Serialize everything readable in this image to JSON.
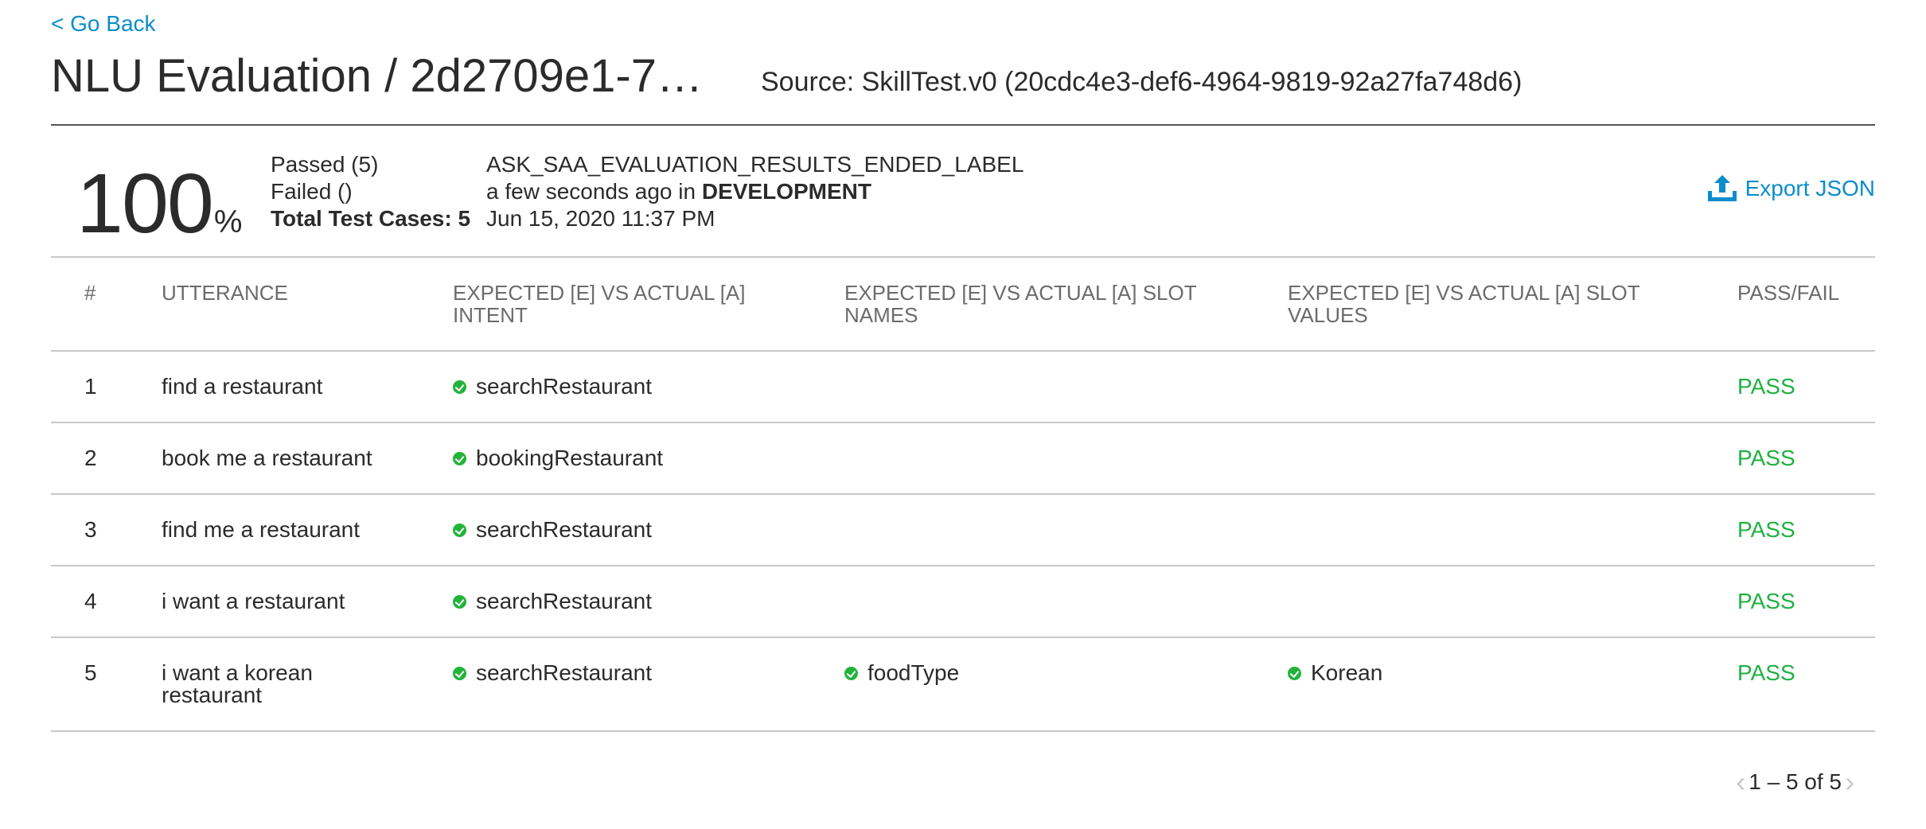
{
  "nav": {
    "back_label": "< Go Back"
  },
  "header": {
    "title": "NLU Evaluation / 2d2709e1-7…",
    "source": "Source: SkillTest.v0 (20cdc4e3-def6-4964-9819-92a27fa748d6)"
  },
  "summary": {
    "percent": "100",
    "percent_sign": "%",
    "passed": "Passed (5)",
    "failed": "Failed ()",
    "total": "Total Test Cases: 5",
    "status_label": "ASK_SAA_EVALUATION_RESULTS_ENDED_LABEL",
    "when_prefix": "a few seconds ago in ",
    "environment": "DEVELOPMENT",
    "date": "Jun 15, 2020 11:37 PM"
  },
  "export": {
    "label": "Export JSON",
    "icon": "upload-icon"
  },
  "table": {
    "headers": {
      "num": "#",
      "utterance": "UTTERANCE",
      "intent": "EXPECTED [E] VS ACTUAL [A] INTENT",
      "slot_names": "EXPECTED [E] VS ACTUAL [A] SLOT NAMES",
      "slot_values": "EXPECTED [E] VS ACTUAL [A] SLOT VALUES",
      "result": "PASS/FAIL"
    },
    "rows": [
      {
        "num": "1",
        "utterance": "find a restaurant",
        "intent": "searchRestaurant",
        "slot_name": "",
        "slot_value": "",
        "result": "PASS"
      },
      {
        "num": "2",
        "utterance": "book me a restaurant",
        "intent": "bookingRestaurant",
        "slot_name": "",
        "slot_value": "",
        "result": "PASS"
      },
      {
        "num": "3",
        "utterance": "find me a restaurant",
        "intent": "searchRestaurant",
        "slot_name": "",
        "slot_value": "",
        "result": "PASS"
      },
      {
        "num": "4",
        "utterance": "i want a restaurant",
        "intent": "searchRestaurant",
        "slot_name": "",
        "slot_value": "",
        "result": "PASS"
      },
      {
        "num": "5",
        "utterance": "i want a korean restaurant",
        "intent": "searchRestaurant",
        "slot_name": "foodType",
        "slot_value": "Korean",
        "result": "PASS"
      }
    ]
  },
  "pagination": {
    "label": "1 – 5 of 5"
  },
  "colors": {
    "accent": "#0a8dcc",
    "pass": "#1fb141",
    "check": "#22b33b"
  }
}
